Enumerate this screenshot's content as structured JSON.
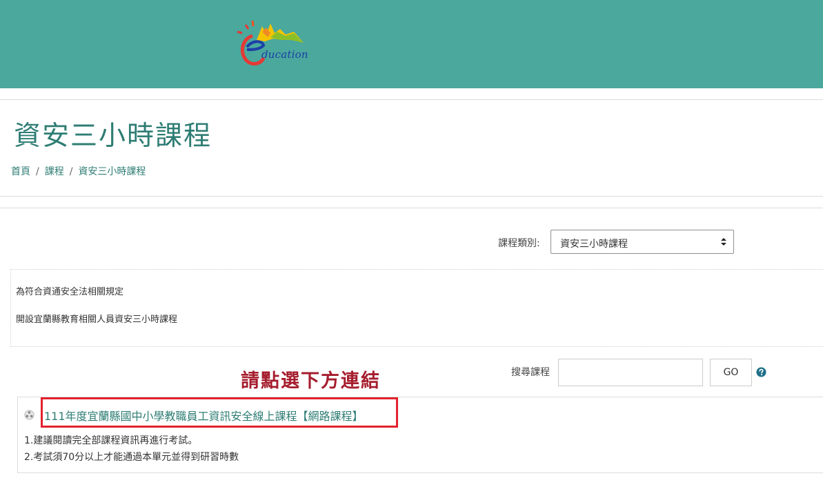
{
  "header": {
    "logo_text": "ducation",
    "background": "#4aa89d"
  },
  "page": {
    "title": "資安三小時課程"
  },
  "breadcrumb": {
    "items": [
      "首頁",
      "課程",
      "資安三小時課程"
    ],
    "separator": "/"
  },
  "category": {
    "label": "課程類別:",
    "selected": "資安三小時課程"
  },
  "description": {
    "lines": [
      "為符合資通安全法相關規定",
      "開設宜蘭縣教育相關人員資安三小時課程"
    ]
  },
  "hint": {
    "text": "請點選下方連結",
    "color": "#a51d2d"
  },
  "search": {
    "label": "搜尋課程",
    "value": "",
    "button_label": "GO"
  },
  "course": {
    "title": "111年度宜蘭縣國中小學教職員工資訊安全線上課程【網路課程】",
    "notes": [
      "1.建議閱讀完全部課程資訊再進行考試。",
      "2.考試須70分以上才能通過本單元並得到研習時數"
    ],
    "highlight_color": "#e3212d"
  },
  "icons": {
    "help": "question-circle-icon",
    "course": "course-category-icon",
    "select": "chevron-up-down-icon"
  }
}
